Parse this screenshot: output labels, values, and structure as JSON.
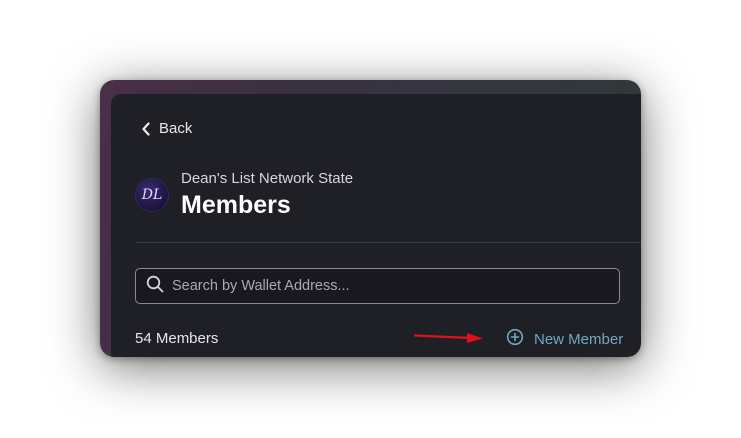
{
  "nav": {
    "back_label": "Back"
  },
  "header": {
    "org_name": "Dean's List Network State",
    "page_title": "Members",
    "logo_text": "DL"
  },
  "search": {
    "placeholder": "Search by Wallet Address..."
  },
  "members": {
    "count_label": "54 Members",
    "new_member_label": "New Member"
  },
  "colors": {
    "accent": "#6fa9bf",
    "panel_bg": "#1f1f26",
    "annotation_arrow": "#e0101a"
  },
  "icons": {
    "back": "chevron-left-icon",
    "search": "search-icon",
    "new_member": "plus-circle-icon",
    "annotation": "red-arrow-icon"
  }
}
